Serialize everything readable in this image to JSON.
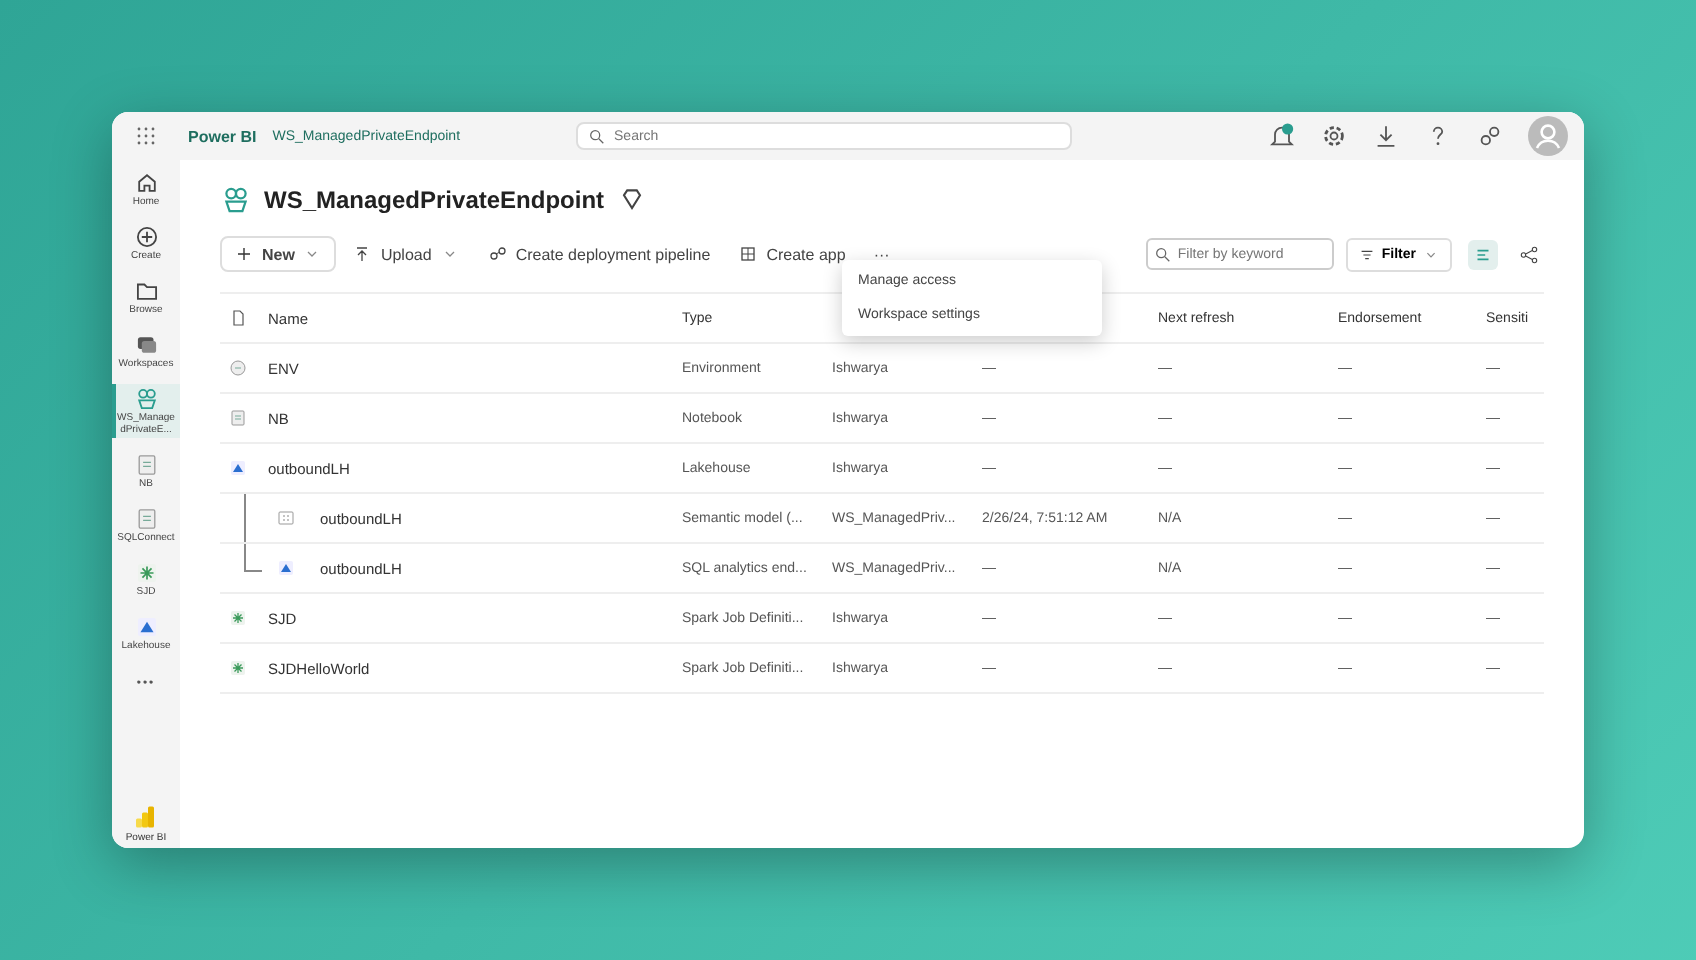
{
  "top_bar": {
    "app_name": "Power BI",
    "breadcrumb": "WS_ManagedPrivateEndpoint",
    "search": {
      "placeholder": "Search"
    }
  },
  "rail": [
    {
      "label": "Home",
      "kind": "home",
      "selected": false
    },
    {
      "label": "Create",
      "kind": "create",
      "selected": false
    },
    {
      "label": "Browse",
      "kind": "browse",
      "selected": false
    },
    {
      "label": "Workspaces",
      "kind": "workspaces",
      "selected": false
    },
    {
      "label": "WS_ManagedPrivateE...",
      "kind": "workspace",
      "selected": true
    },
    {
      "label": "NB",
      "kind": "notebook",
      "selected": false
    },
    {
      "label": "SQLConnect",
      "kind": "notebook",
      "selected": false
    },
    {
      "label": "SJD",
      "kind": "spark_job",
      "selected": false
    },
    {
      "label": "Lakehouse",
      "kind": "lakehouse",
      "selected": false
    },
    {
      "label": "•••",
      "kind": "more",
      "selected": false
    }
  ],
  "rail_footer": {
    "label": "Power BI"
  },
  "workspace": {
    "title": "WS_ManagedPrivateEndpoint"
  },
  "toolbar": {
    "actions": [
      {
        "label": "New",
        "kind": "new"
      },
      {
        "label": "Upload",
        "kind": "upload"
      },
      {
        "label": "Create deployment pipeline",
        "kind": "pipeline"
      },
      {
        "label": "Create app",
        "kind": "app"
      },
      {
        "label": "···",
        "kind": "more"
      }
    ],
    "filter_field": {
      "placeholder": "Filter by keyword"
    },
    "filter_button": "Filter",
    "views": [
      {
        "kind": "list",
        "selected": true
      },
      {
        "kind": "lineage",
        "selected": false
      }
    ]
  },
  "menu": {
    "items": [
      "Manage access",
      "Workspace settings"
    ]
  },
  "table": {
    "columns": {
      "name": "Name",
      "type": "Type",
      "next_refresh": "Next refresh",
      "endorsement": "Endorsement",
      "column_7": "Sensiti"
    },
    "rows": [
      {
        "name": "ENV",
        "kind": "environment",
        "cells": [
          "Environment",
          "Ishwarya",
          "—",
          "—",
          "—",
          "—"
        ]
      },
      {
        "name": "NB",
        "kind": "notebook",
        "cells": [
          "Notebook",
          "Ishwarya",
          "—",
          "—",
          "—",
          "—"
        ]
      },
      {
        "name": "outboundLH",
        "kind": "lakehouse",
        "cells": [
          "Lakehouse",
          "Ishwarya",
          "—",
          "—",
          "—",
          "—"
        ],
        "children": [
          {
            "name": "outboundLH",
            "kind": "semantic_model",
            "cells": [
              "Semantic model (...",
              "WS_ManagedPriv...",
              "2/26/24, 7:51:12 AM",
              "N/A",
              "—",
              "—"
            ]
          },
          {
            "name": "outboundLH",
            "kind": "lakehouse",
            "cells": [
              "SQL analytics end...",
              "WS_ManagedPriv...",
              "—",
              "N/A",
              "—",
              "—"
            ]
          }
        ]
      },
      {
        "name": "SJD",
        "kind": "spark_job",
        "cells": [
          "Spark Job Definiti...",
          "Ishwarya",
          "—",
          "—",
          "—",
          "—"
        ]
      },
      {
        "name": "SJDHelloWorld",
        "kind": "spark_job",
        "cells": [
          "Spark Job Definiti...",
          "Ishwarya",
          "—",
          "—",
          "—",
          "—"
        ]
      }
    ]
  }
}
